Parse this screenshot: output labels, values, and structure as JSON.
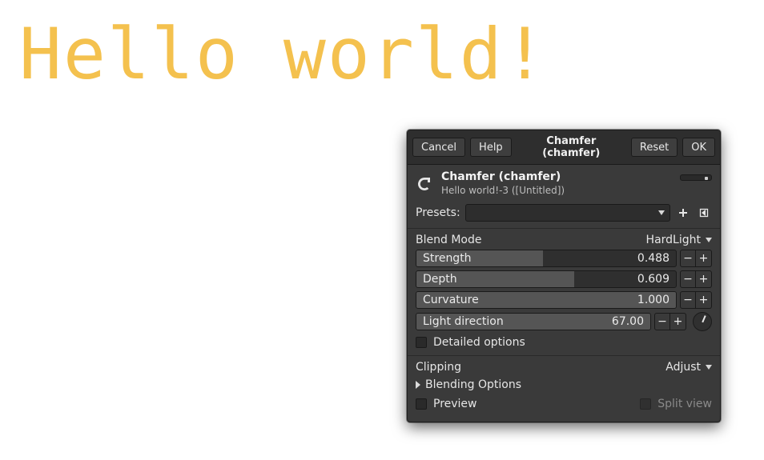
{
  "banner": {
    "text": "Hello world!"
  },
  "titlebar": {
    "cancel": "Cancel",
    "help": "Help",
    "title": "Chamfer (chamfer)",
    "reset": "Reset",
    "ok": "OK"
  },
  "header": {
    "title": "Chamfer (chamfer)",
    "subtitle": "Hello world!-3 ([Untitled])"
  },
  "presets": {
    "label": "Presets:"
  },
  "blend_mode": {
    "label": "Blend Mode",
    "value": "HardLight"
  },
  "sliders": {
    "strength": {
      "label": "Strength",
      "value": "0.488",
      "fill_pct": 48.8
    },
    "depth": {
      "label": "Depth",
      "value": "0.609",
      "fill_pct": 60.9
    },
    "curvature": {
      "label": "Curvature",
      "value": "1.000",
      "fill_pct": 100
    },
    "lightdir": {
      "label": "Light direction",
      "value": "67.00",
      "fill_pct": 100
    }
  },
  "detailed_options": {
    "label": "Detailed options",
    "checked": false
  },
  "clipping": {
    "label": "Clipping",
    "value": "Adjust"
  },
  "blending_options": {
    "label": "Blending Options"
  },
  "preview": {
    "label": "Preview",
    "checked": false
  },
  "splitview": {
    "label": "Split view",
    "checked": false,
    "enabled": false
  }
}
